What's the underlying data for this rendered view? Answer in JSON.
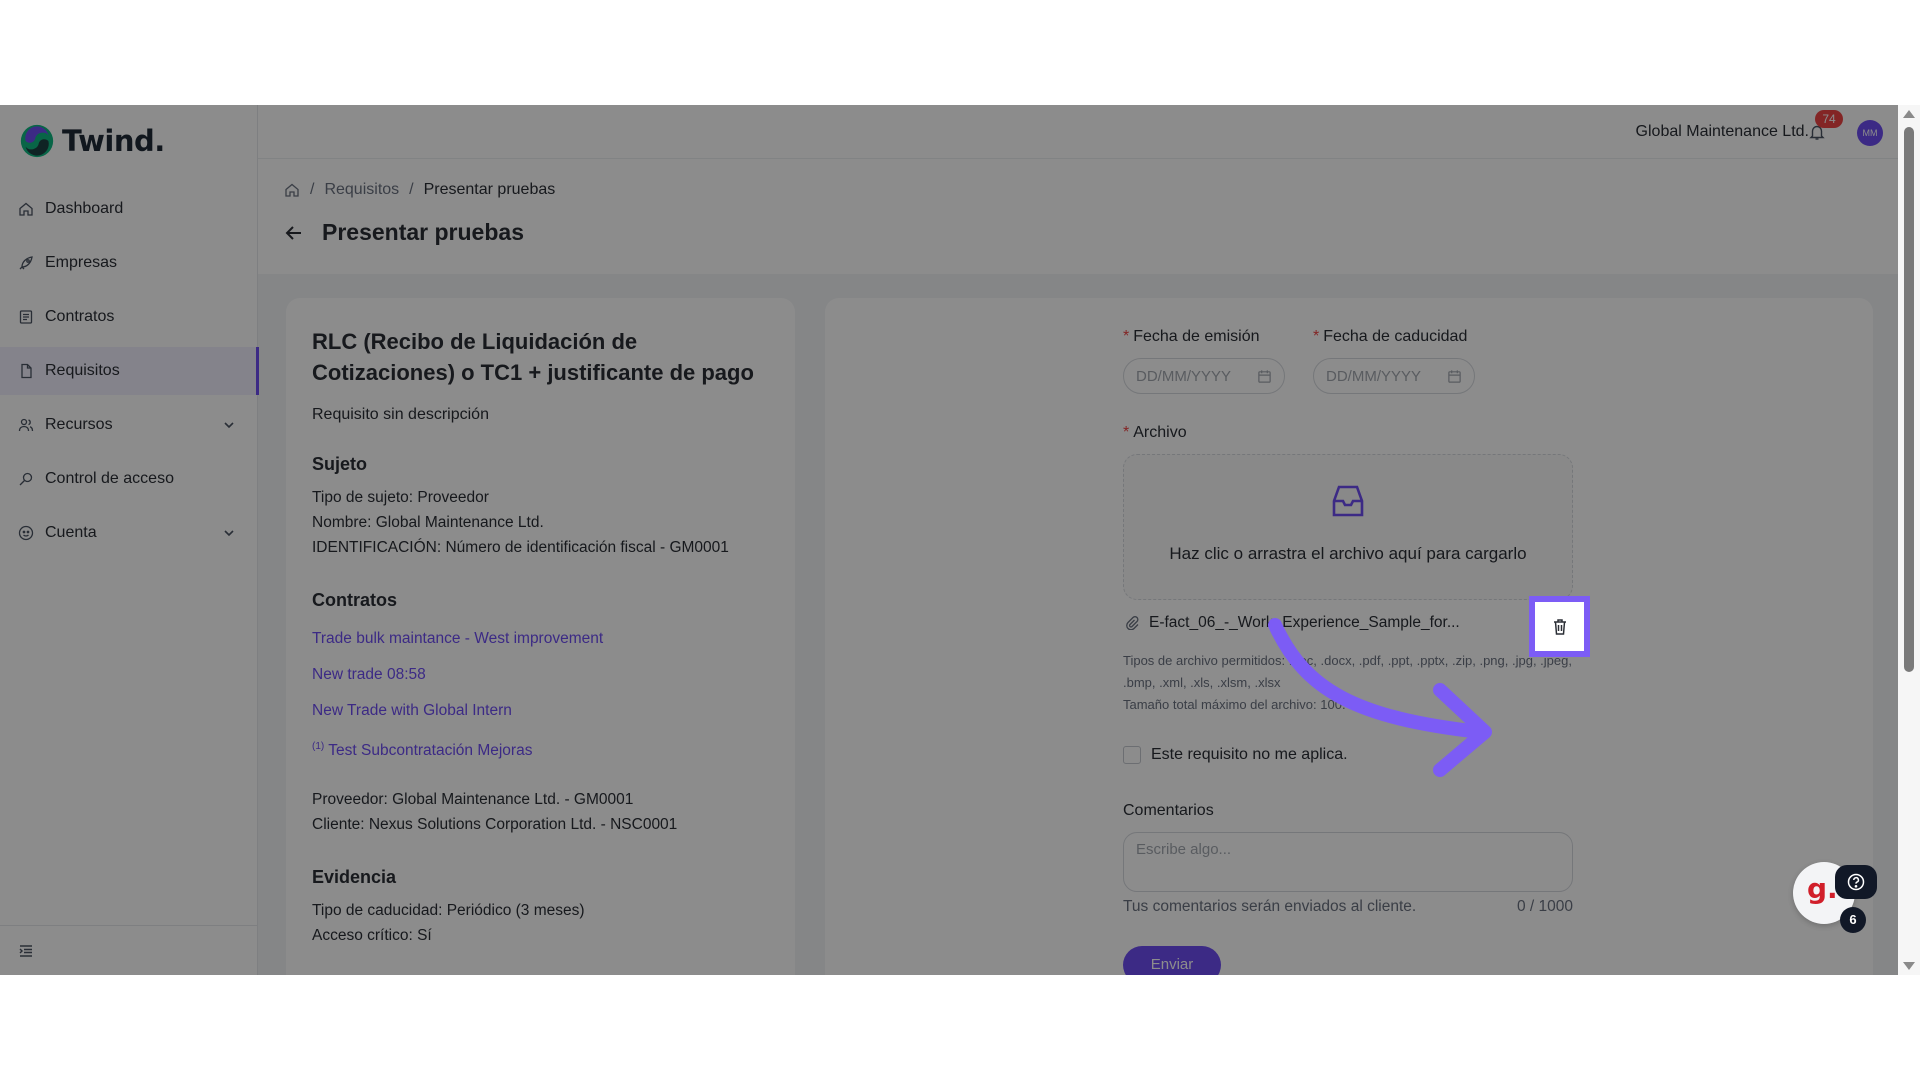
{
  "app": {
    "name": "Twind."
  },
  "header": {
    "company": "Global Maintenance Ltd.",
    "notifications": "74",
    "avatar_initials": "MM"
  },
  "sidebar": {
    "items": [
      {
        "label": "Dashboard",
        "icon": "home-icon"
      },
      {
        "label": "Empresas",
        "icon": "rocket-icon"
      },
      {
        "label": "Contratos",
        "icon": "contract-icon"
      },
      {
        "label": "Requisitos",
        "icon": "document-icon",
        "active": true
      },
      {
        "label": "Recursos",
        "icon": "users-icon",
        "expandable": true
      },
      {
        "label": "Control de acceso",
        "icon": "key-icon"
      },
      {
        "label": "Cuenta",
        "icon": "account-icon",
        "expandable": true
      }
    ]
  },
  "breadcrumb": {
    "items": [
      "Requisitos",
      "Presentar pruebas"
    ]
  },
  "page": {
    "title": "Presentar pruebas"
  },
  "requirement": {
    "title": "RLC (Recibo de Liquidación de Cotizaciones) o TC1 + justificante de pago",
    "description": "Requisito sin descripción",
    "subject": {
      "heading": "Sujeto",
      "type": "Tipo de sujeto: Proveedor",
      "name": "Nombre: Global Maintenance Ltd.",
      "id": "IDENTIFICACIÓN: Número de identificación fiscal - GM0001"
    },
    "contracts": {
      "heading": "Contratos",
      "links": [
        "Trade bulk maintance - West improvement",
        "New trade 08:58",
        "New Trade with Global Intern",
        "Test Subcontratación Mejoras"
      ],
      "sup_prefix": "(1)",
      "provider": "Proveedor: Global Maintenance Ltd. - GM0001",
      "client": "Cliente: Nexus Solutions Corporation Ltd. - NSC0001"
    },
    "evidence": {
      "heading": "Evidencia",
      "expiry_type": "Tipo de caducidad: Periódico (3 meses)",
      "critical": "Acceso crítico: Sí"
    }
  },
  "form": {
    "issue_date_label": "Fecha de emisión",
    "expiry_date_label": "Fecha de caducidad",
    "date_placeholder": "DD/MM/YYYY",
    "file_label": "Archivo",
    "upload_text": "Haz clic o arrastra el archivo aquí para cargarlo",
    "file_name": "E-fact_06_-_Work_Experience_Sample_for...",
    "allowed_types": "Tipos de archivo permitidos: .doc, .docx, .pdf, .ppt, .pptx, .zip, .png, .jpg, .jpeg, .bmp, .xml, .xls, .xlsm, .xlsx",
    "max_size": "Tamaño total máximo del archivo: 100.",
    "not_applicable": "Este requisito no me aplica.",
    "comments_label": "Comentarios",
    "comments_placeholder": "Escribe algo...",
    "comments_hint": "Tus comentarios serán enviados al cliente.",
    "comments_counter": "0 / 1000",
    "submit_label": "Enviar"
  },
  "help": {
    "count": "6"
  },
  "colors": {
    "accent": "#6d4df2",
    "highlight": "#7c5cf5",
    "danger": "#ef4444"
  }
}
